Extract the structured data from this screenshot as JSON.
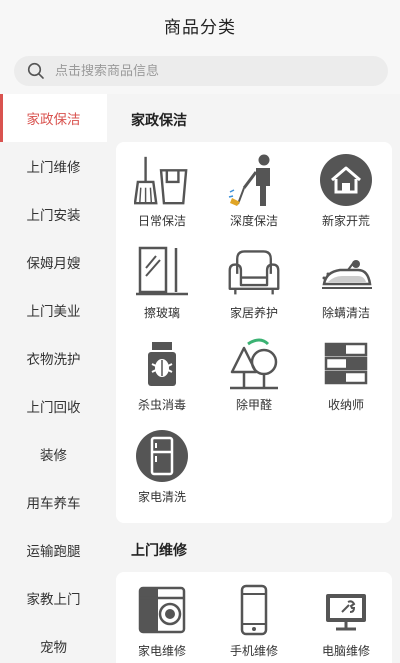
{
  "header": {
    "title": "商品分类"
  },
  "search": {
    "placeholder": "点击搜索商品信息"
  },
  "sidebar": {
    "items": [
      {
        "label": "家政保洁",
        "active": true
      },
      {
        "label": "上门维修"
      },
      {
        "label": "上门安装"
      },
      {
        "label": "保姆月嫂"
      },
      {
        "label": "上门美业"
      },
      {
        "label": "衣物洗护"
      },
      {
        "label": "上门回收"
      },
      {
        "label": "装修"
      },
      {
        "label": "用车养车"
      },
      {
        "label": "运输跑腿"
      },
      {
        "label": "家教上门"
      },
      {
        "label": "宠物"
      }
    ]
  },
  "sections": [
    {
      "title": "家政保洁",
      "items": [
        {
          "label": "日常保洁",
          "icon": "broom-bucket-icon"
        },
        {
          "label": "深度保洁",
          "icon": "cleaner-person-icon"
        },
        {
          "label": "新家开荒",
          "icon": "house-icon"
        },
        {
          "label": "擦玻璃",
          "icon": "window-glass-icon"
        },
        {
          "label": "家居养护",
          "icon": "sofa-icon"
        },
        {
          "label": "除螨清洁",
          "icon": "vacuum-icon"
        },
        {
          "label": "杀虫消毒",
          "icon": "bug-jar-icon"
        },
        {
          "label": "除甲醛",
          "icon": "tree-icon"
        },
        {
          "label": "收纳师",
          "icon": "storage-drawers-icon"
        },
        {
          "label": "家电清洗",
          "icon": "fridge-icon"
        }
      ]
    },
    {
      "title": "上门维修",
      "items": [
        {
          "label": "家电维修",
          "icon": "washing-machine-icon"
        },
        {
          "label": "手机维修",
          "icon": "phone-icon"
        },
        {
          "label": "电脑维修",
          "icon": "computer-wrench-icon"
        }
      ]
    }
  ],
  "colors": {
    "accent": "#d9534f",
    "icon": "#555555",
    "green_accent": "#3bb273"
  }
}
